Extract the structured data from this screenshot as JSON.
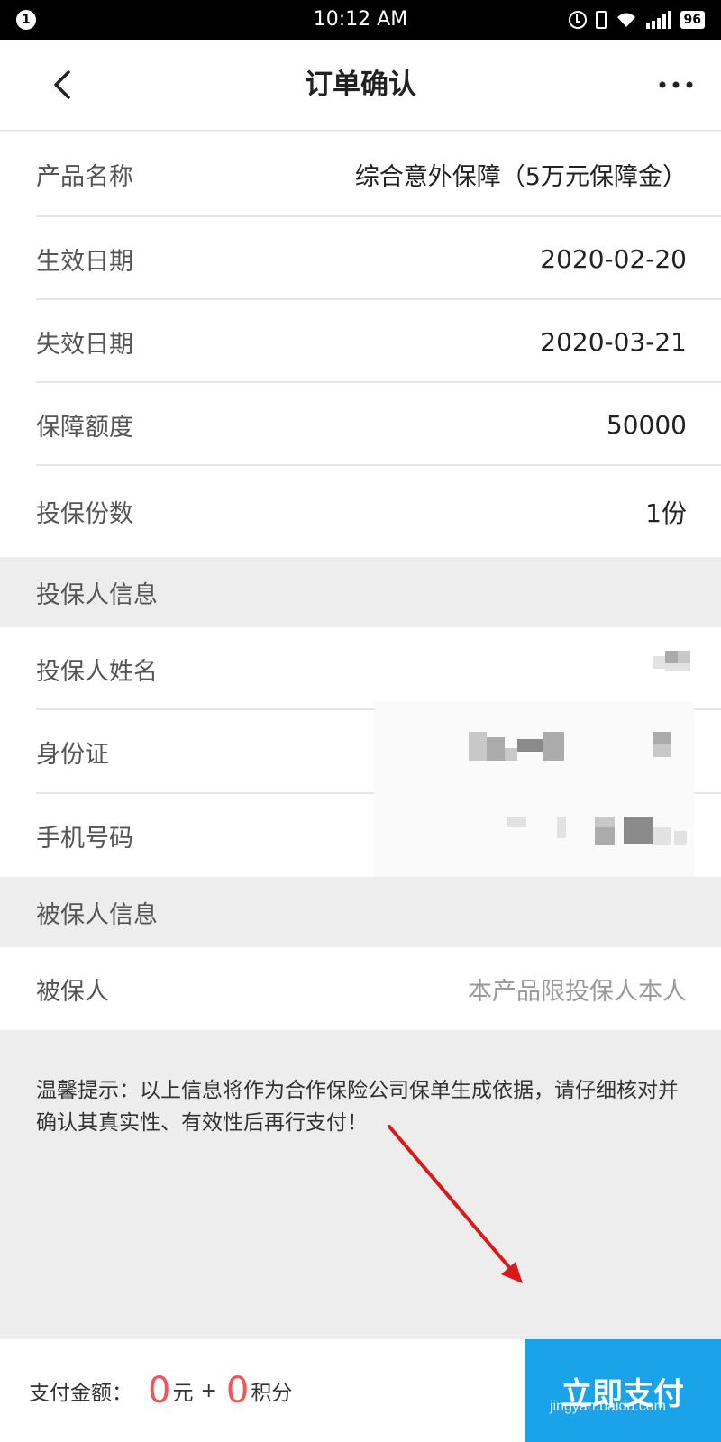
{
  "status_bar": {
    "notification_count": "1",
    "time": "10:12 AM",
    "battery": "96"
  },
  "nav": {
    "title": "订单确认"
  },
  "order": {
    "rows": [
      {
        "label": "产品名称",
        "value": "综合意外保障（5万元保障金）"
      },
      {
        "label": "生效日期",
        "value": "2020-02-20"
      },
      {
        "label": "失效日期",
        "value": "2020-03-21"
      },
      {
        "label": "保障额度",
        "value": "50000"
      },
      {
        "label": "投保份数",
        "value": "1份"
      }
    ]
  },
  "policyholder": {
    "section_title": "投保人信息",
    "rows": [
      {
        "label": "投保人姓名"
      },
      {
        "label": "身份证"
      },
      {
        "label": "手机号码"
      }
    ]
  },
  "insured": {
    "section_title": "被保人信息",
    "label": "被保人",
    "value": "本产品限投保人本人"
  },
  "tip": "温馨提示：以上信息将作为合作保险公司保单生成依据，请仔细核对并确认其真实性、有效性后再行支付！",
  "payment": {
    "label": "支付金额：",
    "cash_amount": "0",
    "cash_unit": "元",
    "plus": "+",
    "points_amount": "0",
    "points_unit": "积分",
    "button_label": "立即支付"
  },
  "watermark": "jingyan.baidu.com",
  "colors": {
    "pay_button": "#1aa3e8",
    "amount": "#f0555a",
    "annotation_arrow": "#d91a1a"
  }
}
